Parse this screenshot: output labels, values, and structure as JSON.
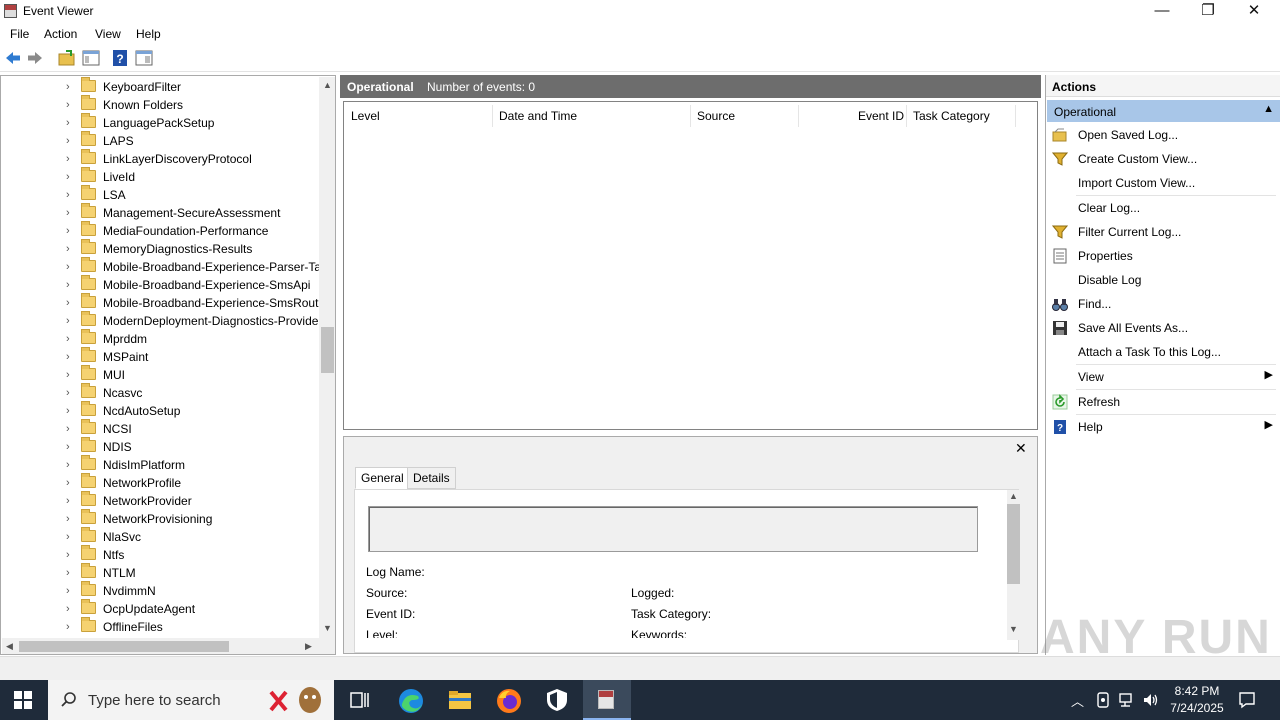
{
  "window": {
    "title": "Event Viewer",
    "controls": {
      "minimize": "—",
      "restore": "❐",
      "close": "✕"
    }
  },
  "menu": [
    "File",
    "Action",
    "View",
    "Help"
  ],
  "toolbar_icons": [
    "back-arrow-icon",
    "forward-arrow-icon",
    "open-folder-icon",
    "show-hide-console-tree-icon",
    "help-icon",
    "show-hide-action-pane-icon"
  ],
  "tree": {
    "items": [
      "KeyboardFilter",
      "Known Folders",
      "LanguagePackSetup",
      "LAPS",
      "LinkLayerDiscoveryProtocol",
      "LiveId",
      "LSA",
      "Management-SecureAssessment",
      "MediaFoundation-Performance",
      "MemoryDiagnostics-Results",
      "Mobile-Broadband-Experience-Parser-Ta",
      "Mobile-Broadband-Experience-SmsApi",
      "Mobile-Broadband-Experience-SmsRout",
      "ModernDeployment-Diagnostics-Provide",
      "Mprddm",
      "MSPaint",
      "MUI",
      "Ncasvc",
      "NcdAutoSetup",
      "NCSI",
      "NDIS",
      "NdisImPlatform",
      "NetworkProfile",
      "NetworkProvider",
      "NetworkProvisioning",
      "NlaSvc",
      "Ntfs",
      "NTLM",
      "NvdimmN",
      "OcpUpdateAgent",
      "OfflineFiles"
    ]
  },
  "center": {
    "log_name": "Operational",
    "event_count": "Number of events: 0",
    "columns": [
      "Level",
      "Date and Time",
      "Source",
      "Event ID",
      "Task Category"
    ]
  },
  "detail": {
    "close": "✕",
    "tabs": [
      "General",
      "Details"
    ],
    "fields": {
      "log_name": "Log Name:",
      "source": "Source:",
      "logged": "Logged:",
      "event_id": "Event ID:",
      "task_category": "Task Category:",
      "level": "Level:",
      "keywords": "Keywords:"
    }
  },
  "actions": {
    "title": "Actions",
    "section": "Operational",
    "items": [
      {
        "label": "Open Saved Log...",
        "icon": "open-log-icon"
      },
      {
        "label": "Create Custom View...",
        "icon": "filter-icon"
      },
      {
        "label": "Import Custom View...",
        "icon": ""
      },
      {
        "label": "Clear Log...",
        "icon": ""
      },
      {
        "label": "Filter Current Log...",
        "icon": "filter-icon"
      },
      {
        "label": "Properties",
        "icon": "properties-icon"
      },
      {
        "label": "Disable Log",
        "icon": ""
      },
      {
        "label": "Find...",
        "icon": "binoculars-icon"
      },
      {
        "label": "Save All Events As...",
        "icon": "save-icon"
      },
      {
        "label": "Attach a Task To this Log...",
        "icon": ""
      },
      {
        "label": "View",
        "icon": "",
        "submenu": true
      },
      {
        "label": "Refresh",
        "icon": "refresh-icon"
      },
      {
        "label": "Help",
        "icon": "help-icon",
        "submenu": true
      }
    ]
  },
  "taskbar": {
    "search_placeholder": "Type here to search",
    "time": "8:42 PM",
    "date": "7/24/2025"
  },
  "watermark": "ANY RUN"
}
